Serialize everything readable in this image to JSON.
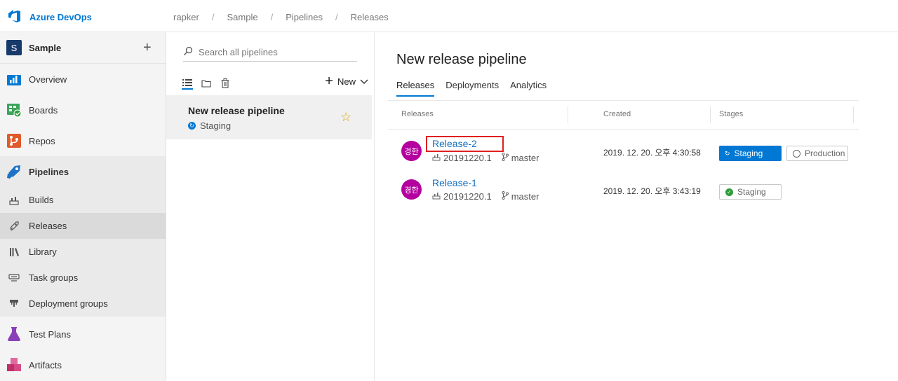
{
  "app": {
    "name": "Azure DevOps"
  },
  "breadcrumb": [
    "rapker",
    "Sample",
    "Pipelines",
    "Releases"
  ],
  "project": {
    "initial": "S",
    "name": "Sample",
    "add_label": "+"
  },
  "nav": {
    "overview": "Overview",
    "boards": "Boards",
    "repos": "Repos",
    "pipelines": "Pipelines",
    "sub": {
      "builds": "Builds",
      "releases": "Releases",
      "library": "Library",
      "task_groups": "Task groups",
      "deployment_groups": "Deployment groups"
    },
    "test_plans": "Test Plans",
    "artifacts": "Artifacts"
  },
  "middle": {
    "search_placeholder": "Search all pipelines",
    "new_label": "New",
    "pipeline": {
      "name": "New release pipeline",
      "status": "Staging",
      "favorite": true
    }
  },
  "main": {
    "title": "New release pipeline",
    "tabs": [
      "Releases",
      "Deployments",
      "Analytics"
    ],
    "active_tab": "Releases",
    "columns": {
      "releases": "Releases",
      "created": "Created",
      "stages": "Stages"
    },
    "rows": [
      {
        "avatar": "경한",
        "name": "Release-2",
        "build": "20191220.1",
        "branch": "master",
        "created": "2019. 12. 20. 오후 4:30:58",
        "stages": [
          {
            "name": "Staging",
            "state": "in-progress"
          },
          {
            "name": "Production",
            "state": "not-started"
          }
        ]
      },
      {
        "avatar": "경한",
        "name": "Release-1",
        "build": "20191220.1",
        "branch": "master",
        "created": "2019. 12. 20. 오후 3:43:19",
        "stages": [
          {
            "name": "Staging",
            "state": "succeeded"
          }
        ]
      }
    ]
  },
  "colors": {
    "accent": "#0078d4",
    "avatar": "#b4009e",
    "highlight": "#e02020",
    "success": "#2e9c3b",
    "star": "#d7a80e"
  }
}
